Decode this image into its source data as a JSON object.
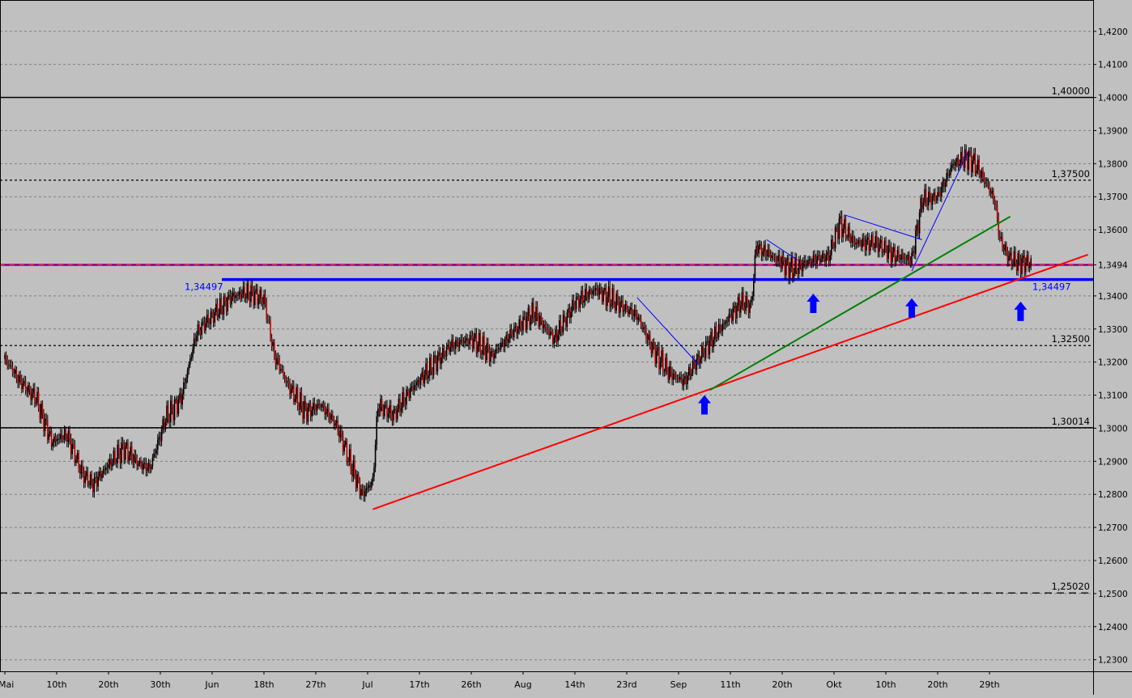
{
  "chart_data": {
    "type": "line",
    "subtype": "candlestick-price-chart",
    "background": "#c0c0c0",
    "grid": true,
    "y_axis": {
      "position": "right",
      "min": 1.2265,
      "max": 1.4285,
      "ticks": [
        {
          "value": 1.42,
          "label": "1,4200"
        },
        {
          "value": 1.41,
          "label": "1,4100"
        },
        {
          "value": 1.4,
          "label": "1,4000"
        },
        {
          "value": 1.39,
          "label": "1,3900"
        },
        {
          "value": 1.38,
          "label": "1,3800"
        },
        {
          "value": 1.37,
          "label": "1,3700"
        },
        {
          "value": 1.36,
          "label": "1,3600"
        },
        {
          "value": 1.3494,
          "label": "1,3494"
        },
        {
          "value": 1.34,
          "label": "1,3400"
        },
        {
          "value": 1.33,
          "label": "1,3300"
        },
        {
          "value": 1.32,
          "label": "1,3200"
        },
        {
          "value": 1.31,
          "label": "1,3100"
        },
        {
          "value": 1.3,
          "label": "1,3000"
        },
        {
          "value": 1.29,
          "label": "1,2900"
        },
        {
          "value": 1.28,
          "label": "1,2800"
        },
        {
          "value": 1.27,
          "label": "1,2700"
        },
        {
          "value": 1.26,
          "label": "1,2600"
        },
        {
          "value": 1.25,
          "label": "1,2500"
        },
        {
          "value": 1.24,
          "label": "1,2400"
        },
        {
          "value": 1.23,
          "label": "1,2300"
        }
      ]
    },
    "x_axis": {
      "day_min": 0,
      "day_max": 214,
      "ticks": [
        {
          "day": 0,
          "label": "Mai"
        },
        {
          "day": 10,
          "label": "10th"
        },
        {
          "day": 20,
          "label": "20th"
        },
        {
          "day": 30,
          "label": "30th"
        },
        {
          "day": 40,
          "label": "Jun"
        },
        {
          "day": 50,
          "label": "18th"
        },
        {
          "day": 60,
          "label": "27th"
        },
        {
          "day": 70,
          "label": "Jul"
        },
        {
          "day": 80,
          "label": "17th"
        },
        {
          "day": 90,
          "label": "26th"
        },
        {
          "day": 100,
          "label": "Aug"
        },
        {
          "day": 110,
          "label": "14th"
        },
        {
          "day": 120,
          "label": "23rd"
        },
        {
          "day": 130,
          "label": "Sep"
        },
        {
          "day": 140,
          "label": "11th"
        },
        {
          "day": 150,
          "label": "20th"
        },
        {
          "day": 160,
          "label": "Okt"
        },
        {
          "day": 170,
          "label": "10th"
        },
        {
          "day": 180,
          "label": "20th"
        },
        {
          "day": 190,
          "label": "29th"
        }
      ]
    },
    "price_path": [
      [
        0,
        1.321
      ],
      [
        3,
        1.314
      ],
      [
        6,
        1.309
      ],
      [
        9,
        1.296
      ],
      [
        12,
        1.298
      ],
      [
        15,
        1.286
      ],
      [
        17,
        1.283
      ],
      [
        20,
        1.289
      ],
      [
        23,
        1.294
      ],
      [
        26,
        1.289
      ],
      [
        28,
        1.288
      ],
      [
        31,
        1.303
      ],
      [
        34,
        1.309
      ],
      [
        37,
        1.329
      ],
      [
        40,
        1.334
      ],
      [
        44,
        1.34
      ],
      [
        47,
        1.341
      ],
      [
        50,
        1.339
      ],
      [
        52,
        1.322
      ],
      [
        55,
        1.312
      ],
      [
        58,
        1.305
      ],
      [
        61,
        1.307
      ],
      [
        64,
        1.301
      ],
      [
        67,
        1.288
      ],
      [
        69,
        1.28
      ],
      [
        71,
        1.284
      ],
      [
        72,
        1.307
      ],
      [
        75,
        1.304
      ],
      [
        78,
        1.311
      ],
      [
        82,
        1.318
      ],
      [
        86,
        1.325
      ],
      [
        90,
        1.327
      ],
      [
        94,
        1.322
      ],
      [
        98,
        1.329
      ],
      [
        102,
        1.335
      ],
      [
        106,
        1.327
      ],
      [
        110,
        1.338
      ],
      [
        114,
        1.342
      ],
      [
        118,
        1.338
      ],
      [
        122,
        1.334
      ],
      [
        125,
        1.324
      ],
      [
        128,
        1.317
      ],
      [
        131,
        1.314
      ],
      [
        133,
        1.319
      ],
      [
        136,
        1.326
      ],
      [
        139,
        1.332
      ],
      [
        142,
        1.338
      ],
      [
        144,
        1.337
      ],
      [
        145,
        1.355
      ],
      [
        148,
        1.352
      ],
      [
        152,
        1.348
      ],
      [
        156,
        1.351
      ],
      [
        159,
        1.352
      ],
      [
        161,
        1.362
      ],
      [
        164,
        1.356
      ],
      [
        168,
        1.356
      ],
      [
        172,
        1.352
      ],
      [
        175,
        1.351
      ],
      [
        177,
        1.369
      ],
      [
        180,
        1.37
      ],
      [
        183,
        1.38
      ],
      [
        186,
        1.382
      ],
      [
        188,
        1.378
      ],
      [
        191,
        1.369
      ],
      [
        192,
        1.357
      ],
      [
        194,
        1.351
      ],
      [
        196,
        1.35
      ],
      [
        198,
        1.35
      ]
    ],
    "horizontal_lines": [
      {
        "value": 1.4,
        "label": "1,40000",
        "color": "#000000",
        "style": "solid"
      },
      {
        "value": 1.375,
        "label": "1,37500",
        "color": "#000000",
        "style": "dotted"
      },
      {
        "value": 1.3494,
        "label": "",
        "color": "#800080",
        "style": "solid"
      },
      {
        "value": 1.34497,
        "label": "1,34497",
        "color": "#0000ff",
        "style": "solid-thick"
      },
      {
        "value": 1.325,
        "label": "1,32500",
        "color": "#000000",
        "style": "dotted"
      },
      {
        "value": 1.30014,
        "label": "1,30014",
        "color": "#000000",
        "style": "solid"
      },
      {
        "value": 1.2502,
        "label": "1,25020",
        "color": "#000000",
        "style": "dashed"
      }
    ],
    "trend_lines": [
      {
        "color": "#ff0000",
        "from": [
          71,
          1.2755
        ],
        "to": [
          209,
          1.3525
        ]
      },
      {
        "color": "#008000",
        "from": [
          136,
          1.3115
        ],
        "to": [
          194,
          1.364
        ]
      },
      {
        "color": "#0000ff",
        "from": [
          122,
          1.3395
        ],
        "to": [
          134,
          1.319
        ]
      },
      {
        "color": "#0000ff",
        "from": [
          147,
          1.357
        ],
        "to": [
          153,
          1.3508
        ]
      },
      {
        "color": "#0000ff",
        "from": [
          162,
          1.3645
        ],
        "to": [
          177,
          1.357
        ]
      },
      {
        "color": "#0000ff",
        "from": [
          175,
          1.3475
        ],
        "to": [
          186,
          1.384
        ]
      }
    ],
    "arrows": [
      {
        "day": 135,
        "value": 1.31,
        "color": "#0000ff",
        "direction": "up"
      },
      {
        "day": 156,
        "value": 1.3407,
        "color": "#0000ff",
        "direction": "up"
      },
      {
        "day": 175,
        "value": 1.3393,
        "color": "#0000ff",
        "direction": "up"
      },
      {
        "day": 196,
        "value": 1.3383,
        "color": "#0000ff",
        "direction": "up"
      }
    ],
    "annotations": [
      {
        "text": "1,34497",
        "color": "#0000ff",
        "anchor": "left-of-blue-line-start"
      },
      {
        "text": "1,34497",
        "color": "#0000ff",
        "anchor": "right-end-of-blue-line"
      }
    ]
  }
}
